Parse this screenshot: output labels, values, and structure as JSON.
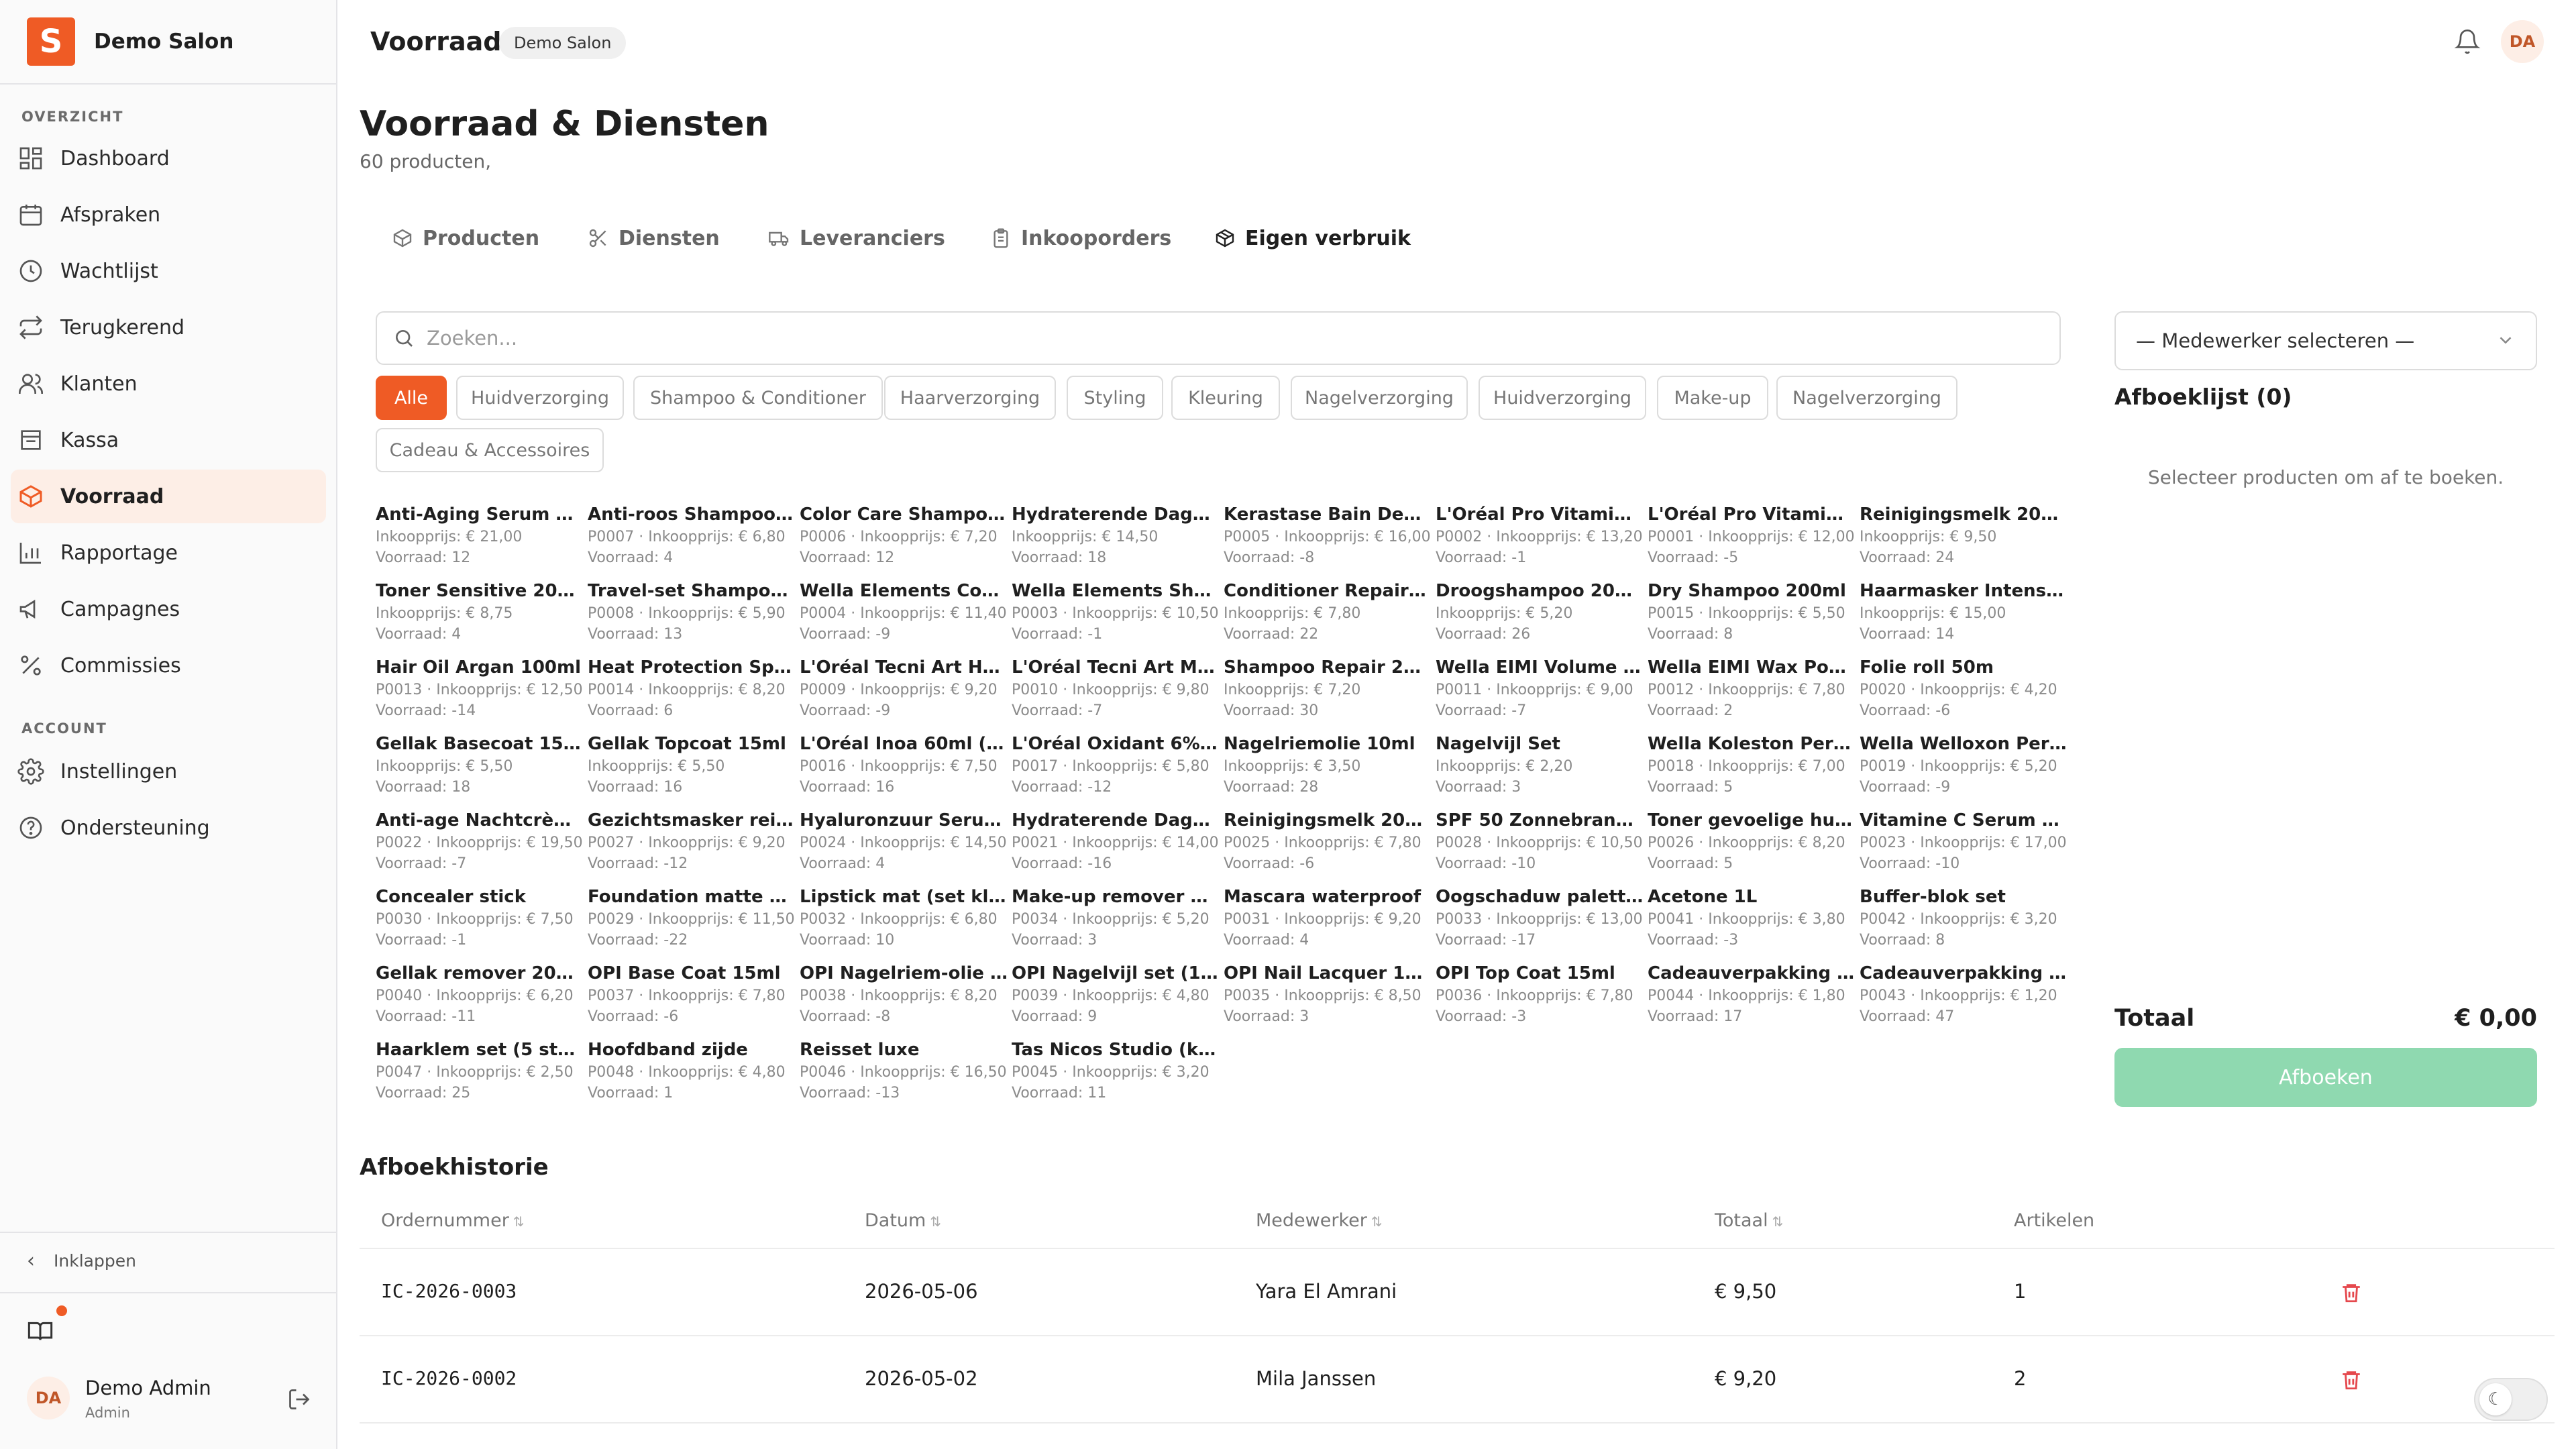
{
  "brand": {
    "logo_letter": "S",
    "name": "Demo Salon"
  },
  "sidebar": {
    "section_overview": "OVERZICHT",
    "section_account": "ACCOUNT",
    "items": [
      {
        "label": "Dashboard",
        "icon": "dashboard-icon"
      },
      {
        "label": "Afspraken",
        "icon": "calendar-icon"
      },
      {
        "label": "Wachtlijst",
        "icon": "clock-icon"
      },
      {
        "label": "Terugkerend",
        "icon": "repeat-icon"
      },
      {
        "label": "Klanten",
        "icon": "users-icon"
      },
      {
        "label": "Kassa",
        "icon": "register-icon"
      },
      {
        "label": "Voorraad",
        "icon": "box-icon",
        "active": true
      },
      {
        "label": "Rapportage",
        "icon": "bar-chart-icon"
      },
      {
        "label": "Campagnes",
        "icon": "megaphone-icon"
      },
      {
        "label": "Commissies",
        "icon": "percent-icon"
      },
      {
        "label": "Instellingen",
        "icon": "gear-icon"
      },
      {
        "label": "Ondersteuning",
        "icon": "help-icon"
      }
    ],
    "collapse_label": "Inklappen",
    "user": {
      "initials": "DA",
      "name": "Demo Admin",
      "role": "Admin"
    }
  },
  "header": {
    "title": "Voorraad",
    "badge": "Demo Salon",
    "avatar_initials": "DA"
  },
  "page": {
    "title": "Voorraad & Diensten",
    "subtitle": "60 producten,"
  },
  "tabs": [
    {
      "label": "Producten",
      "icon": "package-icon"
    },
    {
      "label": "Diensten",
      "icon": "scissors-icon"
    },
    {
      "label": "Leveranciers",
      "icon": "truck-icon"
    },
    {
      "label": "Inkooporders",
      "icon": "clipboard-icon"
    },
    {
      "label": "Eigen verbruik",
      "icon": "package-open-icon",
      "active": true
    }
  ],
  "search": {
    "placeholder": "Zoeken..."
  },
  "chips": [
    "Alle",
    "Huidverzorging",
    "Shampoo & Conditioner",
    "Haarverzorging",
    "Styling",
    "Kleuring",
    "Nagelverzorging",
    "Huidverzorging",
    "Make-up",
    "Nagelverzorging",
    "Cadeau & Accessoires"
  ],
  "products": [
    {
      "name": "Anti-Aging Serum 30...",
      "price": "Inkoopprijs: € 21,00",
      "stock": "Voorraad: 12"
    },
    {
      "name": "Anti-roos Shampoo ...",
      "price": "P0007 · Inkoopprijs: € 6,80",
      "stock": "Voorraad: 4"
    },
    {
      "name": "Color Care Shampoo...",
      "price": "P0006 · Inkoopprijs: € 7,20",
      "stock": "Voorraad: 12"
    },
    {
      "name": "Hydraterende Dagcr...",
      "price": "Inkoopprijs: € 14,50",
      "stock": "Voorraad: 18"
    },
    {
      "name": "Kerastase Bain Dens...",
      "price": "P0005 · Inkoopprijs: € 16,00",
      "stock": "Voorraad: -8"
    },
    {
      "name": "L'Oréal Pro Vitamino...",
      "price": "P0002 · Inkoopprijs: € 13,20",
      "stock": "Voorraad: -1"
    },
    {
      "name": "L'Oréal Pro Vitamino...",
      "price": "P0001 · Inkoopprijs: € 12,00",
      "stock": "Voorraad: -5"
    },
    {
      "name": "Reinigingsmelk 200ml",
      "price": "Inkoopprijs: € 9,50",
      "stock": "Voorraad: 24"
    },
    {
      "name": "Toner Sensitive 200ml",
      "price": "Inkoopprijs: € 8,75",
      "stock": "Voorraad: 4"
    },
    {
      "name": "Travel-set Shampoo ...",
      "price": "P0008 · Inkoopprijs: € 5,90",
      "stock": "Voorraad: 13"
    },
    {
      "name": "Wella Elements Con...",
      "price": "P0004 · Inkoopprijs: € 11,40",
      "stock": "Voorraad: -9"
    },
    {
      "name": "Wella Elements Sha...",
      "price": "P0003 · Inkoopprijs: € 10,50",
      "stock": "Voorraad: -1"
    },
    {
      "name": "Conditioner Repair 2...",
      "price": "Inkoopprijs: € 7,80",
      "stock": "Voorraad: 22"
    },
    {
      "name": "Droogshampoo 200ml",
      "price": "Inkoopprijs: € 5,20",
      "stock": "Voorraad: 26"
    },
    {
      "name": "Dry Shampoo 200ml",
      "price": "P0015 · Inkoopprijs: € 5,50",
      "stock": "Voorraad: 8"
    },
    {
      "name": "Haarmasker Intense ...",
      "price": "Inkoopprijs: € 15,00",
      "stock": "Voorraad: 14"
    },
    {
      "name": "Hair Oil Argan 100ml",
      "price": "P0013 · Inkoopprijs: € 12,50",
      "stock": "Voorraad: -14"
    },
    {
      "name": "Heat Protection Spr...",
      "price": "P0014 · Inkoopprijs: € 8,20",
      "stock": "Voorraad: 6"
    },
    {
      "name": "L'Oréal Tecni Art Hai...",
      "price": "P0009 · Inkoopprijs: € 9,20",
      "stock": "Voorraad: -9"
    },
    {
      "name": "L'Oréal Tecni Art Mo...",
      "price": "P0010 · Inkoopprijs: € 9,80",
      "stock": "Voorraad: -7"
    },
    {
      "name": "Shampoo Repair 250...",
      "price": "Inkoopprijs: € 7,20",
      "stock": "Voorraad: 30"
    },
    {
      "name": "Wella EIMI Volume M...",
      "price": "P0011 · Inkoopprijs: € 9,00",
      "stock": "Voorraad: -7"
    },
    {
      "name": "Wella EIMI Wax Pom...",
      "price": "P0012 · Inkoopprijs: € 7,80",
      "stock": "Voorraad: 2"
    },
    {
      "name": "Folie roll 50m",
      "price": "P0020 · Inkoopprijs: € 4,20",
      "stock": "Voorraad: -6"
    },
    {
      "name": "Gellak Basecoat 15ml",
      "price": "Inkoopprijs: € 5,50",
      "stock": "Voorraad: 18"
    },
    {
      "name": "Gellak Topcoat 15ml",
      "price": "Inkoopprijs: € 5,50",
      "stock": "Voorraad: 16"
    },
    {
      "name": "L'Oréal Inoa 60ml (v...",
      "price": "P0016 · Inkoopprijs: € 7,50",
      "stock": "Voorraad: 16"
    },
    {
      "name": "L'Oréal Oxidant 6% 1L",
      "price": "P0017 · Inkoopprijs: € 5,80",
      "stock": "Voorraad: -12"
    },
    {
      "name": "Nagelriemolie 10ml",
      "price": "Inkoopprijs: € 3,50",
      "stock": "Voorraad: 28"
    },
    {
      "name": "Nagelvijl Set",
      "price": "Inkoopprijs: € 2,20",
      "stock": "Voorraad: 3"
    },
    {
      "name": "Wella Koleston Perfe...",
      "price": "P0018 · Inkoopprijs: € 7,00",
      "stock": "Voorraad: 5"
    },
    {
      "name": "Wella Welloxon Perf...",
      "price": "P0019 · Inkoopprijs: € 5,20",
      "stock": "Voorraad: -9"
    },
    {
      "name": "Anti-age Nachtcrèm...",
      "price": "P0022 · Inkoopprijs: € 19,50",
      "stock": "Voorraad: -7"
    },
    {
      "name": "Gezichtsmasker rein...",
      "price": "P0027 · Inkoopprijs: € 9,20",
      "stock": "Voorraad: -12"
    },
    {
      "name": "Hyaluronzuur Serum...",
      "price": "P0024 · Inkoopprijs: € 14,50",
      "stock": "Voorraad: 4"
    },
    {
      "name": "Hydraterende Dagcr...",
      "price": "P0021 · Inkoopprijs: € 14,00",
      "stock": "Voorraad: -16"
    },
    {
      "name": "Reinigingsmelk 200ml",
      "price": "P0025 · Inkoopprijs: € 7,80",
      "stock": "Voorraad: -6"
    },
    {
      "name": "SPF 50 Zonnebrand ...",
      "price": "P0028 · Inkoopprijs: € 10,50",
      "stock": "Voorraad: -10"
    },
    {
      "name": "Toner gevoelige huid...",
      "price": "P0026 · Inkoopprijs: € 8,20",
      "stock": "Voorraad: 5"
    },
    {
      "name": "Vitamine C Serum 3...",
      "price": "P0023 · Inkoopprijs: € 17,00",
      "stock": "Voorraad: -10"
    },
    {
      "name": "Concealer stick",
      "price": "P0030 · Inkoopprijs: € 7,50",
      "stock": "Voorraad: -1"
    },
    {
      "name": "Foundation matte 3...",
      "price": "P0029 · Inkoopprijs: € 11,50",
      "stock": "Voorraad: -22"
    },
    {
      "name": "Lipstick mat (set kle...",
      "price": "P0032 · Inkoopprijs: € 6,80",
      "stock": "Voorraad: 10"
    },
    {
      "name": "Make-up remover 20...",
      "price": "P0034 · Inkoopprijs: € 5,20",
      "stock": "Voorraad: 3"
    },
    {
      "name": "Mascara waterproof",
      "price": "P0031 · Inkoopprijs: € 9,20",
      "stock": "Voorraad: 4"
    },
    {
      "name": "Oogschaduw palette...",
      "price": "P0033 · Inkoopprijs: € 13,00",
      "stock": "Voorraad: -17"
    },
    {
      "name": "Acetone 1L",
      "price": "P0041 · Inkoopprijs: € 3,80",
      "stock": "Voorraad: -3"
    },
    {
      "name": "Buffer-blok set",
      "price": "P0042 · Inkoopprijs: € 3,20",
      "stock": "Voorraad: 8"
    },
    {
      "name": "Gellak remover 200ml",
      "price": "P0040 · Inkoopprijs: € 6,20",
      "stock": "Voorraad: -11"
    },
    {
      "name": "OPI Base Coat 15ml",
      "price": "P0037 · Inkoopprijs: € 7,80",
      "stock": "Voorraad: -6"
    },
    {
      "name": "OPI Nagelriem-olie 1...",
      "price": "P0038 · Inkoopprijs: € 8,20",
      "stock": "Voorraad: -8"
    },
    {
      "name": "OPI Nagelvijl set (10...",
      "price": "P0039 · Inkoopprijs: € 4,80",
      "stock": "Voorraad: 9"
    },
    {
      "name": "OPI Nail Lacquer 15ml",
      "price": "P0035 · Inkoopprijs: € 8,50",
      "stock": "Voorraad: 3"
    },
    {
      "name": "OPI Top Coat 15ml",
      "price": "P0036 · Inkoopprijs: € 7,80",
      "stock": "Voorraad: -3"
    },
    {
      "name": "Cadeauverpakking l...",
      "price": "P0044 · Inkoopprijs: € 1,80",
      "stock": "Voorraad: 17"
    },
    {
      "name": "Cadeauverpakking s...",
      "price": "P0043 · Inkoopprijs: € 1,20",
      "stock": "Voorraad: 47"
    },
    {
      "name": "Haarklem set (5 stu...",
      "price": "P0047 · Inkoopprijs: € 2,50",
      "stock": "Voorraad: 25"
    },
    {
      "name": "Hoofdband zijde",
      "price": "P0048 · Inkoopprijs: € 4,80",
      "stock": "Voorraad: 1"
    },
    {
      "name": "Reisset luxe",
      "price": "P0046 · Inkoopprijs: € 16,50",
      "stock": "Voorraad: -13"
    },
    {
      "name": "Tas Nicos Studio (ka...",
      "price": "P0045 · Inkoopprijs: € 3,20",
      "stock": "Voorraad: 11"
    }
  ],
  "panel": {
    "employee_placeholder": "— Medewerker selecteren —",
    "list_title": "Afboeklijst (0)",
    "empty_text": "Selecteer producten om af te boeken.",
    "total_label": "Totaal",
    "total_value": "€ 0,00",
    "button_label": "Afboeken"
  },
  "history": {
    "title": "Afboekhistorie",
    "columns": [
      "Ordernummer",
      "Datum",
      "Medewerker",
      "Totaal",
      "Artikelen"
    ],
    "sort_symbol": "⇅",
    "rows": [
      {
        "order": "IC-2026-0003",
        "date": "2026-05-06",
        "employee": "Yara El Amrani",
        "total": "€ 9,50",
        "items": "1"
      },
      {
        "order": "IC-2026-0002",
        "date": "2026-05-02",
        "employee": "Mila Janssen",
        "total": "€ 9,20",
        "items": "2"
      }
    ]
  },
  "colors": {
    "accent": "#ef5b25",
    "accent_soft": "#fdeee6",
    "success_disabled": "#8fd9b0",
    "danger": "#e5484d"
  }
}
